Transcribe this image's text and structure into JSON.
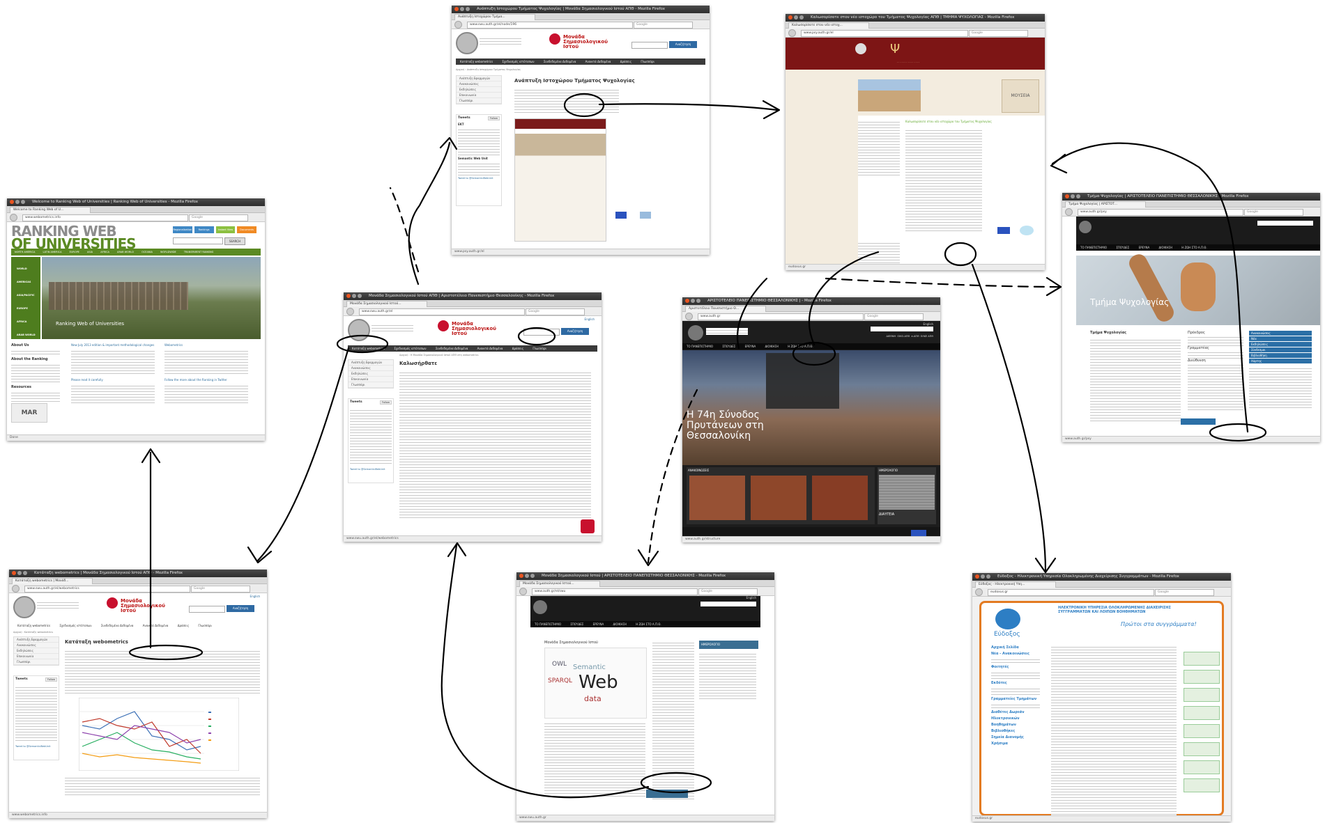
{
  "windows": {
    "ranking": {
      "title": "Welcome to Ranking Web of Universities | Ranking Web of Universities - Mozilla Firefox",
      "tab": "Welcome to Ranking Web of U...",
      "url": "www.webometrics.info",
      "search": "Google",
      "logo_line1": "RANKING WEB",
      "logo_line2": "OF UNIVERSITIES",
      "search_button": "SEARCH",
      "top_buttons": [
        "Regionalization",
        "Rankings",
        "Instant View",
        "Documents"
      ],
      "regions": [
        "WORLD",
        "AMERICAS",
        "ASIA/PACIFIC",
        "EUROPE",
        "AFRICA",
        "ARAB WORLD"
      ],
      "nav_tabs": [
        "NORTH AMERICA",
        "LATIN AMERICA",
        "EUROPE",
        "ASIA",
        "AFRICA",
        "ARAB WORLD",
        "OCEANIA",
        "WORLDWIDE",
        "TRANSPARENT RANKING"
      ],
      "banner": "Ranking Web of Universities",
      "about_us": "About Us",
      "about_ranking": "About the Ranking",
      "resources": "Resources",
      "news1": "New July 2013 edition & important methodological changes",
      "news2": "Webometrics",
      "news3": "Please read it carefully",
      "news4": "Follow the more about the Ranking in Twitter",
      "more1": "READ MORE",
      "status": "Done"
    },
    "msi_psy": {
      "title": "Ανάπτυξη Ιστοχώρου Τμήματος Ψυχολογίας | Μονάδα Σημασιολογικού Ιστού ΑΠΘ - Mozilla Firefox",
      "tab": "Ανάπτυξη Ιστοχώρου Τμήμα...",
      "url": "www.swu.auth.gr/el/node/196",
      "search": "Google",
      "logo": "Μονάδα Σημασιολογικού Ιστού",
      "search_button": "Αναζήτηση",
      "menu": [
        "Κατάταξη webometrics",
        "Σχεδιασμός ιστότοπων",
        "Συνδεδεμένα Δεδομένα",
        "Ανοικτά Δεδομένα",
        "Δράσεις",
        "Γλωσσάρι"
      ],
      "breadcrumb": "Αρχική › Ανάπτυξη Ιστοχώρου Τμήματος Ψυχολογίας",
      "heading": "Ανάπτυξη Ιστοχώρου Τμήματος Ψυχολογίας",
      "side_items": [
        "Ανάπτυξη Εφαρμογών",
        "Ανακοινώσεις",
        "Εκδηλώσεις",
        "Επικοινωνία",
        "Γλωσσάρι"
      ],
      "tweets": "Tweets",
      "follow": "Follow",
      "tweet_user": "ΕΚΤ",
      "tweet_user2": "Semantic Web Unit",
      "tweet_to": "Tweet to @SemanticWebUnit",
      "status": "www.psy.auth.gr/el"
    },
    "psy_old": {
      "title": "Καλωσορίσατε στον νέο ιστοχώρο του Τμήματος Ψυχολογίας ΑΠΘ | ΤΜΗΜΑ ΨΥΧΟΛΟΓΙΑΣ - Mozilla Firefox",
      "tab": "Καλωσορίσατε στον νέο ιστοχ...",
      "url": "www.psy.auth.gr/el",
      "search": "Google",
      "photo_caption": "ΜΟΥΣΕΙΑ",
      "welcome": "Καλωσορίσατε στον νέο ιστοχώρο του Τμήματος Ψυχολογίας",
      "status": "eudoxus.gr"
    },
    "swu_home": {
      "title": "Μονάδα Σημασιολογικού Ιστού ΑΠΘ | Αριστοτέλειο Πανεπιστήμιο Θεσσαλονίκης - Mozilla Firefox",
      "tab": "Μονάδα Σημασιολογικού Ιστού...",
      "url": "www.swu.auth.gr/el",
      "search": "Google",
      "logo": "Μονάδα Σημασιολογικού Ιστού",
      "search_button": "Αναζήτηση",
      "lang": "English",
      "menu": [
        "Κατάταξη webometrics",
        "Σχεδιασμός ιστότοπων",
        "Συνδεδεμένα Δεδομένα",
        "Ανοικτά Δεδομένα",
        "Δράσεις",
        "Γλωσσάρι"
      ],
      "breadcrumb": "Αρχική › Η Μονάδα Σημασιολογικού Ιστού ΑΠΘ στη webometrics",
      "heading": "Καλωσήρθατε",
      "side_items": [
        "Ανάπτυξη Εφαρμογών",
        "Ανακοινώσεις",
        "Εκδηλώσεις",
        "Επικοινωνία",
        "Γλωσσάρι"
      ],
      "tweets": "Tweets",
      "follow": "Follow",
      "tweet_to": "Tweet to @SemanticWebUnit",
      "status": "www.swu.auth.gr/el/webometrics"
    },
    "auth_main": {
      "title": "ΑΡΙΣΤΟΤΕΛΕΙΟ ΠΑΝΕΠΙΣΤΗΜΙΟ ΘΕΣΣΑΛΟΝΙΚΗΣ | - Mozilla Firefox",
      "tab": "Αριστοτέλειο Πανεπιστήμιο Θ...",
      "url": "www.auth.gr",
      "search": "Google",
      "lang": "English",
      "menu": [
        "ΤΟ ΠΑΝΕΠΙΣΤΗΜΙΟ",
        "ΣΠΟΥΔΕΣ",
        "ΕΡΕΥΝΑ",
        "ΔΙΟΙΚΗΣΗ",
        "Η ΖΩΗ ΣΤΟ Α.Π.Θ."
      ],
      "top_links": [
        "ΔΙΕΘΝΗ",
        "ΟΙΚΟ-ΑΠΘ",
        "e-ΑΠΘ",
        "ΕΛΚΕ ΑΠΘ"
      ],
      "hero_line1": "Η 74η Σύνοδος",
      "hero_line2": "Πρυτάνεων στη",
      "hero_line3": "Θεσσαλονίκη",
      "news_label": "ΑΝΑΚΟΙΝΩΣΕΙΣ",
      "events_label": "ΗΜΕΡΟΛΟΓΙΟ",
      "diavgeia": "ΔΙΑΥΓΕΙΑ",
      "status": "www.auth.gr/structure"
    },
    "psy_new": {
      "title": "Τμήμα Ψυχολογίας | ΑΡΙΣΤΟΤΕΛΕΙΟ ΠΑΝΕΠΙΣΤΗΜΙΟ ΘΕΣΣΑΛΟΝΙΚΗΣ - Mozilla Firefox",
      "tab": "Τμήμα Ψυχολογίας | ΑΡΙΣΤΟΤ...",
      "url": "www.auth.gr/psy",
      "search": "Google",
      "menu": [
        "ΤΟ ΠΑΝΕΠΙΣΤΗΜΙΟ",
        "ΣΠΟΥΔΕΣ",
        "ΕΡΕΥΝΑ",
        "ΔΙΟΙΚΗΣΗ",
        "Η ΖΩΗ ΣΤΟ Α.Π.Θ."
      ],
      "hero": "Τμήμα Ψυχολογίας",
      "section": "Τμήμα Ψυχολογίας",
      "president": "Πρόεδρος",
      "secretary": "Γραμματέας",
      "address": "Διεύθυνση",
      "side_items": [
        "Ανακοινώσεις",
        "Νέα",
        "Εκδηλώσεις",
        "Σύνδεσμοι",
        "Βιβλιοθήκη",
        "Χάρτης"
      ],
      "status": "www.auth.gr/psy"
    },
    "webometrics_page": {
      "title": "Κατάταξη webometrics | Μονάδα Σημασιολογικού Ιστού ΑΠΘ - Mozilla Firefox",
      "tab": "Κατάταξη webometrics | Μονάδ...",
      "url": "www.swu.auth.gr/el/webometrics",
      "search": "Google",
      "logo": "Μονάδα Σημασιολογικού Ιστού",
      "search_button": "Αναζήτηση",
      "lang": "English",
      "menu": [
        "Κατάταξη webometrics",
        "Σχεδιασμός ιστότοπων",
        "Συνδεδεμένα Δεδομένα",
        "Ανοικτά Δεδομένα",
        "Δράσεις",
        "Γλωσσάρι"
      ],
      "breadcrumb": "Αρχική › Κατάταξη webometrics",
      "heading": "Κατάταξη webometrics",
      "side_items": [
        "Ανάπτυξη Εφαρμογών",
        "Ανακοινώσεις",
        "Εκδηλώσεις",
        "Επικοινωνία",
        "Γλωσσάρι"
      ],
      "tweets": "Tweets",
      "follow": "Follow",
      "tweet_to": "Tweet to @SemanticWebUnit",
      "status": "www.webometrics.info"
    },
    "auth_swu": {
      "title": "Μονάδα Σημασιολογικού Ιστού | ΑΡΙΣΤΟΤΕΛΕΙΟ ΠΑΝΕΠΙΣΤΗΜΙΟ ΘΕΣΣΑΛΟΝΙΚΗΣ - Mozilla Firefox",
      "tab": "Μονάδα Σημασιολογικού Ιστού...",
      "url": "www.auth.gr/el/swu",
      "search": "Google",
      "lang": "English",
      "menu": [
        "ΤΟ ΠΑΝΕΠΙΣΤΗΜΙΟ",
        "ΣΠΟΥΔΕΣ",
        "ΕΡΕΥΝΑ",
        "ΔΙΟΙΚΗΣΗ",
        "Η ΖΩΗ ΣΤΟ Α.Π.Θ."
      ],
      "heading": "Μονάδα Σημασιολογικού Ιστού",
      "cloud_word1": "Web",
      "cloud_word2": "data",
      "cloud_word3": "Semantic",
      "cloud_word4": "SPARQL",
      "cloud_word5": "OWL",
      "side_heading": "ΗΜΕΡΟΛΟΓΙΟ",
      "status": "www.swu.auth.gr"
    },
    "eudoxus": {
      "title": "Εύδοξος - Ηλεκτρονική Υπηρεσία Ολοκληρωμένης Διαχείρισης Συγγραμμάτων - Mozilla Firefox",
      "tab": "Εύδοξος - Ηλεκτρονική Υπη...",
      "url": "eudoxus.gr",
      "search": "Google",
      "banner": "ΗΛΕΚΤΡΟΝΙΚΗ ΥΠΗΡΕΣΙΑ ΟΛΟΚΛΗΡΩΜΕΝΗΣ ΔΙΑΧΕΙΡΙΣΗΣ ΣΥΓΓΡΑΜΜΑΤΩΝ ΚΑΙ ΛΟΙΠΩΝ ΒΟΗΘΗΜΑΤΩΝ",
      "slogan": "Πρώτοι στα συγγράμματα!",
      "logo": "Εύδοξος",
      "side_items": [
        "Αρχική Σελίδα",
        "Νέα - Ανακοινώσεις",
        "Φοιτητές",
        "Εκδότες",
        "Γραμματείες Τμημάτων",
        "Διαθέτες Δωρεάν Ηλεκτρονικών Βοηθημάτων",
        "Βιβλιοθήκες",
        "Σημεία Διανομής",
        "Χρήσιμα"
      ],
      "status": "eudoxus.gr"
    }
  }
}
